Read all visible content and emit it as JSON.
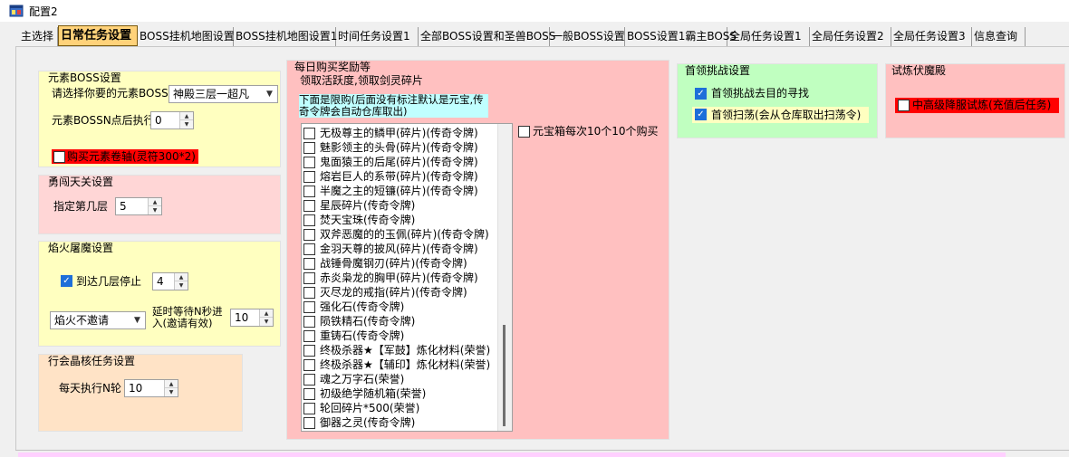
{
  "window": {
    "title": "配置2"
  },
  "tabs": [
    {
      "label": "主选择",
      "active": false
    },
    {
      "label": "日常任务设置",
      "active": true
    },
    {
      "label": "BOSS挂机地图设置",
      "active": false
    },
    {
      "label": "BOSS挂机地图设置1",
      "active": false
    },
    {
      "label": "时间任务设置1",
      "active": false
    },
    {
      "label": "全部BOSS设置和圣兽BOSS",
      "active": false
    },
    {
      "label": "一般BOSS设置",
      "active": false
    },
    {
      "label": "BOSS设置1霸主BOSS",
      "active": false
    },
    {
      "label": "全局任务设置1",
      "active": false
    },
    {
      "label": "全局任务设置2",
      "active": false
    },
    {
      "label": "全局任务设置3",
      "active": false
    },
    {
      "label": "信息查询",
      "active": false
    }
  ],
  "element_boss": {
    "title": "元素BOSS设置",
    "select_label": "请选择你要的元素BOSS",
    "select_value": "神殿三层一超凡",
    "time_label": "元素BOSSN点后执行",
    "time_value": "0",
    "buy_label": "购买元素卷轴(灵符300*2)",
    "buy_checked": false
  },
  "brave": {
    "title": "勇闯天关设置",
    "floor_label": "指定第几层",
    "floor_value": "5"
  },
  "flame": {
    "title": "焰火屠魔设置",
    "stop_label": "到达几层停止",
    "stop_checked": true,
    "stop_value": "4",
    "invite_value": "焰火不邀请",
    "delay_label": "延时等待N秒进入(邀请有效)",
    "delay_value": "10"
  },
  "guild": {
    "title": "行会晶核任务设置",
    "rounds_label": "每天执行N轮",
    "rounds_value": "10"
  },
  "daily_buy": {
    "title": "每日购买奖励等",
    "sub_label": "领取活跃度,领取剑灵碎片",
    "note": "下面是限购(后面没有标注默认是元宝,传奇令牌会自动仓库取出)",
    "yuanbao_label": "元宝箱每次10个10个购买",
    "yuanbao_checked": false,
    "items": [
      "无极尊主的鳞甲(碎片)(传奇令牌)",
      "魅影领主的头骨(碎片)(传奇令牌)",
      "鬼面猿王的后尾(碎片)(传奇令牌)",
      "熔岩巨人的系带(碎片)(传奇令牌)",
      "半魔之主的短镰(碎片)(传奇令牌)",
      "星辰碎片(传奇令牌)",
      "焚天宝珠(传奇令牌)",
      "双斧恶魔的的玉佩(碎片)(传奇令牌)",
      "金羽天尊的披风(碎片)(传奇令牌)",
      "战锤骨魔钢刃(碎片)(传奇令牌)",
      "赤炎枭龙的胸甲(碎片)(传奇令牌)",
      "灭尽龙的戒指(碎片)(传奇令牌)",
      "强化石(传奇令牌)",
      "陨铁精石(传奇令牌)",
      "重铸石(传奇令牌)",
      "终极杀器★【军鼓】炼化材料(荣誉)",
      "终极杀器★【辅印】炼化材料(荣誉)",
      "魂之万字石(荣誉)",
      "初级绝学随机箱(荣誉)",
      "轮回碎片*500(荣誉)",
      "御器之灵(传奇令牌)"
    ]
  },
  "leader": {
    "title": "首领挑战设置",
    "seek_label": "首领挑战去目的寻找",
    "seek_checked": true,
    "sweep_label": "首领扫荡(会从仓库取出扫荡令)",
    "sweep_checked": true
  },
  "trial": {
    "title": "试炼伏魔殿",
    "option_label": "中高级降服试炼(充值后任务)",
    "option_checked": false
  },
  "colors": {
    "active_tab": "#ffd27a",
    "highlight_red": "#ff0000",
    "note_cyan": "#c0ffff",
    "check_blue": "#1e6fd9"
  }
}
